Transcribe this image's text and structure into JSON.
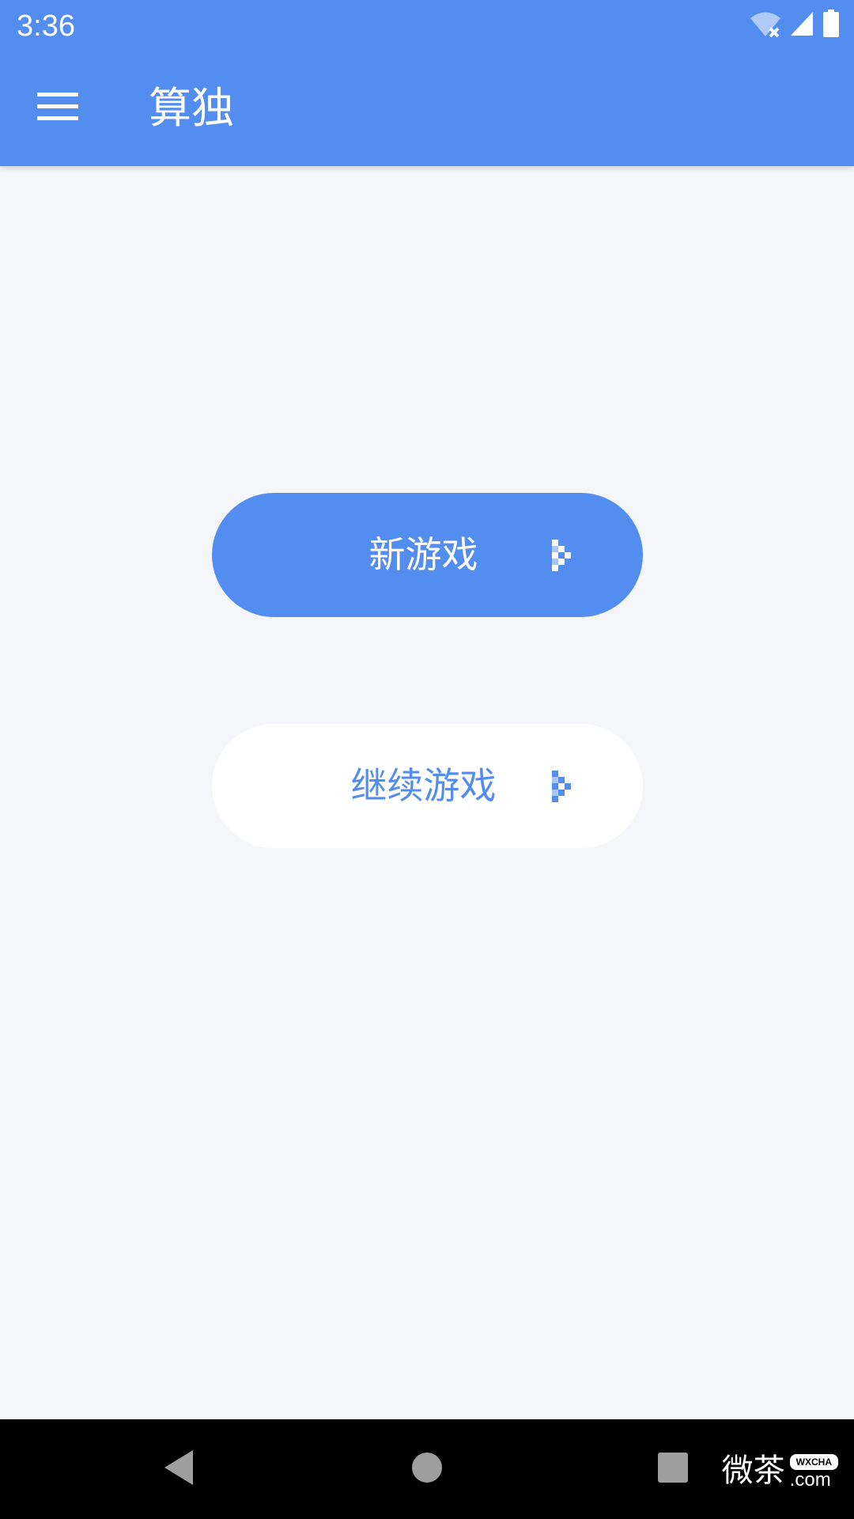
{
  "status_bar": {
    "time": "3:36",
    "icons": [
      "wifi-off-icon",
      "cellular-signal-icon",
      "battery-icon"
    ]
  },
  "app_bar": {
    "menu_icon": "hamburger-menu-icon",
    "title": "算独"
  },
  "main": {
    "new_game_label": "新游戏",
    "continue_game_label": "继续游戏",
    "arrow_icon": "chevron-right-icon"
  },
  "nav_bar": {
    "icons": [
      "back-icon",
      "home-icon",
      "recents-icon"
    ]
  },
  "watermark": {
    "text_cn": "微茶",
    "badge": "WXCHA",
    "domain": ".com"
  },
  "colors": {
    "primary": "#528def",
    "background": "#f4f6fa",
    "white": "#ffffff",
    "nav_bar": "#000000"
  }
}
